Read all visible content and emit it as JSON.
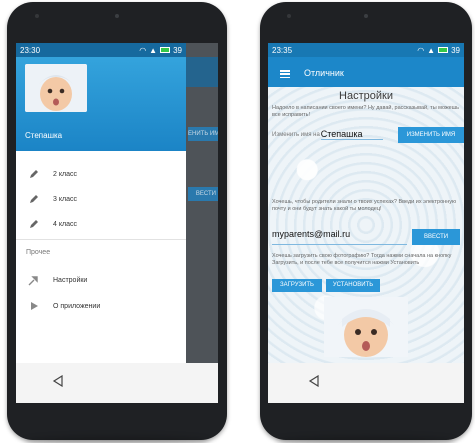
{
  "left": {
    "status": {
      "time": "23:30",
      "battery": "39"
    },
    "drawer": {
      "name": "Степашка",
      "items": [
        {
          "label": "2 класс",
          "icon": "pencil-icon"
        },
        {
          "label": "3 класс",
          "icon": "pencil-icon"
        },
        {
          "label": "4 класс",
          "icon": "pencil-icon"
        }
      ],
      "section": "Прочее",
      "extra_items": [
        {
          "label": "Настройки",
          "icon": "settings-icon"
        },
        {
          "label": "О приложении",
          "icon": "play-icon"
        }
      ]
    },
    "behind": {
      "button1": "ЕНИТЬ ИМЯ",
      "button2": "ВЕСТИ"
    }
  },
  "right": {
    "status": {
      "time": "23:35",
      "battery": "39"
    },
    "app_title": "Отличник",
    "page_title": "Настройки",
    "intro": "Надоело в написании своего имени? Ну давай, рассказывай, ты можешь все исправить!",
    "name_prefix": "Изменить имя на",
    "name_value": "Степашка",
    "change_name_button": "ИЗМЕНИТЬ ИМЯ",
    "parents_text": "Хочешь, чтобы родители знали о твоих успехах? Введи их электронную почту и они будут знать какой ты молодец!",
    "email_value": "myparents@mail.ru",
    "enter_button": "ВВЕСТИ",
    "photo_text": "Хочешь загрузить свою фотографию? Тогда нажми сначала на кнопку Загрузить, и после тебе все получится нажми Установить",
    "upload_button": "ЗАГРУЗИТЬ",
    "set_button": "УСТАНОВИТЬ"
  },
  "colors": {
    "primary": "#1c87c9",
    "button": "#2b97d8",
    "battery": "#35c84a"
  }
}
